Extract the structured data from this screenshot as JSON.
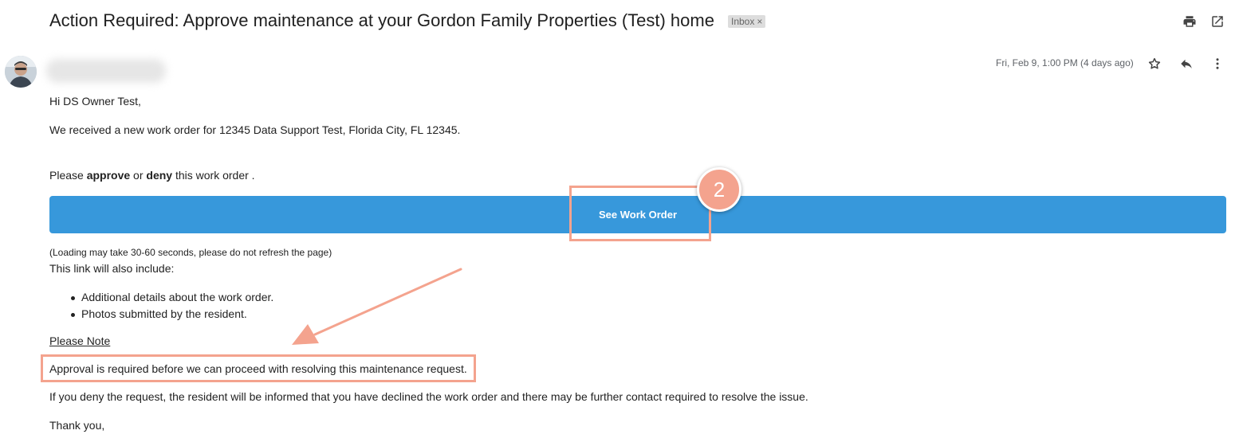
{
  "email": {
    "subject": "Action Required: Approve maintenance at your Gordon Family Properties (Test) home",
    "label": "Inbox",
    "label_remove": "×",
    "date": "Fri, Feb 9, 1:00 PM (4 days ago)"
  },
  "body": {
    "greeting": "Hi DS Owner Test,",
    "received": "We received a new work order for 12345 Data Support Test, Florida City, FL 12345.",
    "please_prefix": "Please ",
    "approve": "approve",
    "or": " or ",
    "deny": "deny",
    "please_suffix": " this work order .",
    "cta_label": "See Work Order",
    "loading_note": "(Loading may take 30-60 seconds, please do not refresh the page)",
    "link_includes": "This link will also include:",
    "bullets": [
      "Additional details about the work order.",
      "Photos submitted by the resident."
    ],
    "please_note": "Please Note",
    "approval_required": "Approval is required before we can proceed with resolving this maintenance request.",
    "deny_info": "If you deny the request, the resident will be informed that you have declined the work order and there may be further contact required to resolve the issue.",
    "thanks": "Thank you,"
  },
  "annotations": {
    "step_number": "2",
    "highlight_color": "#f4a38e"
  },
  "colors": {
    "cta_background": "#3798db",
    "cta_text": "#ffffff"
  },
  "icons": [
    "print-icon",
    "open-in-new-window-icon",
    "star-icon",
    "reply-icon",
    "more-vert-icon",
    "avatar"
  ]
}
